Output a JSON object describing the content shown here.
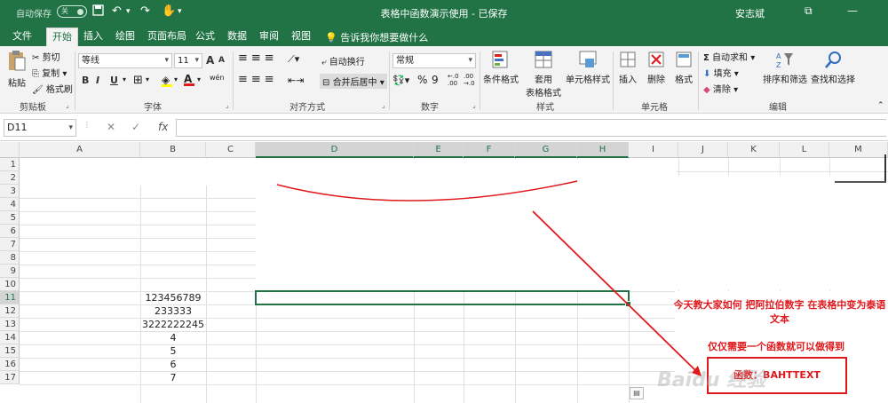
{
  "titlebar": {
    "autosave_label": "自动保存",
    "autosave_state": "关",
    "title": "表格中函数演示使用 - 已保存",
    "user": "安志斌"
  },
  "tabs": [
    "文件",
    "开始",
    "插入",
    "绘图",
    "页面布局",
    "公式",
    "数据",
    "审阅",
    "视图"
  ],
  "tellme": "告诉我你想要做什么",
  "ribbon": {
    "clipboard": {
      "paste": "粘贴",
      "cut": "剪切",
      "copy": "复制",
      "format_painter": "格式刷",
      "label": "剪贴板"
    },
    "font": {
      "name": "等线",
      "size": "11",
      "label": "字体",
      "grow": "A",
      "shrink": "A",
      "bold": "B",
      "italic": "I",
      "underline": "U",
      "wen": "wén"
    },
    "alignment": {
      "wrap": "自动换行",
      "merge": "合并后居中",
      "label": "对齐方式"
    },
    "number": {
      "format": "常规",
      "percent": "%",
      "comma": "9",
      "inc": "←.0 .00",
      "dec": ".00 →.0",
      "label": "数字"
    },
    "styles": {
      "conditional": "条件格式",
      "table": "套用",
      "table2": "表格格式",
      "cell_styles": "单元格样式",
      "label": "样式"
    },
    "cells": {
      "insert": "插入",
      "delete": "删除",
      "format": "格式",
      "label": "单元格"
    },
    "editing": {
      "autosum": "自动求和",
      "fill": "填充",
      "clear": "清除",
      "sort": "排序和筛选",
      "find": "查找和选择",
      "label": "编辑"
    }
  },
  "formula_bar": {
    "name_box": "D11",
    "cancel": "✕",
    "enter": "✓",
    "fx": "fx",
    "value": ""
  },
  "columns": [
    "A",
    "B",
    "C",
    "D",
    "E",
    "F",
    "G",
    "H",
    "I",
    "J",
    "K",
    "L",
    "M"
  ],
  "rows": [
    "1",
    "2",
    "3",
    "4",
    "5",
    "6",
    "7",
    "8",
    "9",
    "10",
    "11",
    "12",
    "13",
    "14",
    "15",
    "16",
    "17"
  ],
  "cells": {
    "B11": "123456789",
    "B12": "233333",
    "B13": "3222222245",
    "B14": "4",
    "B15": "5",
    "B16": "6",
    "B17": "7"
  },
  "annotations": {
    "note1": "今天教大家如何 把阿拉伯数字 在表格中变为泰语文本",
    "note2": "仅仅需要一个函数就可以做得到",
    "function_box": "函数：BAHTTEXT"
  },
  "watermark": "Baidu 经验",
  "colors": {
    "excel_green": "#217346",
    "annotation_red": "#e0191d"
  }
}
